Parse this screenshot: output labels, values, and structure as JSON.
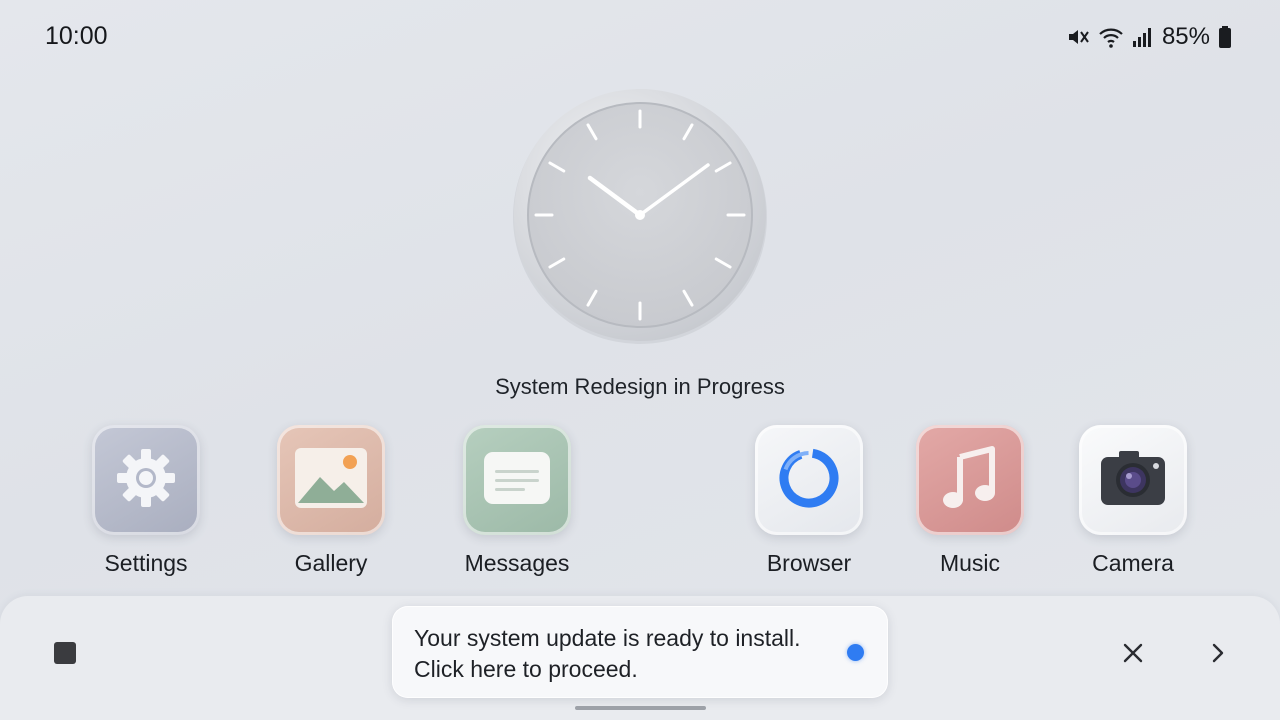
{
  "status_bar": {
    "time": "10:00",
    "icons": [
      "mute-icon",
      "wifi-icon",
      "signal-icon",
      "battery-icon"
    ],
    "battery_percent": "85%"
  },
  "clock_widget": {
    "caption": "System Redesign in Progress",
    "shown_time": "10:10"
  },
  "apps": [
    {
      "label": "Settings",
      "icon": "gear-icon"
    },
    {
      "label": "Gallery",
      "icon": "image-icon"
    },
    {
      "label": "Messages",
      "icon": "message-icon"
    },
    {
      "label": "Browser",
      "icon": "browser-icon"
    },
    {
      "label": "Music",
      "icon": "music-note-icon"
    },
    {
      "label": "Camera",
      "icon": "camera-icon"
    }
  ],
  "bottom_bar": {
    "notification": {
      "line1": "Your system update is ready to install.",
      "line2": "Click here to proceed."
    },
    "controls": [
      "stop-icon",
      "close-icon",
      "chevron-right-icon"
    ]
  },
  "colors": {
    "accent": "#2f7cf2",
    "background": "#e2e5ea",
    "settings_tile": "#b3b8c9",
    "gallery_tile": "#dbb9aa",
    "messages_tile": "#a9c3b2",
    "browser_tile": "#eef0f4",
    "music_tile": "#d99a99",
    "camera_tile": "#f2f3f5"
  }
}
